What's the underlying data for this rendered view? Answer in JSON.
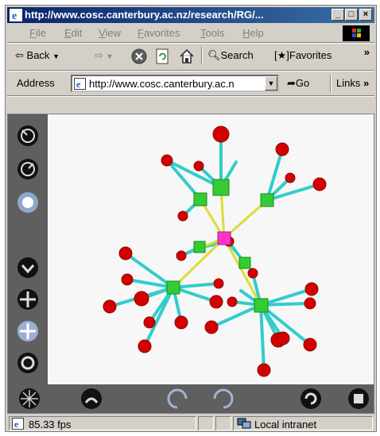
{
  "window": {
    "title": "http://www.cosc.canterbury.ac.nz/research/RG/..."
  },
  "title_buttons": {
    "minimize": "_",
    "maximize": "□",
    "close": "×"
  },
  "menu": [
    {
      "key": "F",
      "rest": "ile"
    },
    {
      "key": "E",
      "rest": "dit"
    },
    {
      "key": "V",
      "rest": "iew"
    },
    {
      "key": "F",
      "rest": "avorites",
      "prefix": ""
    },
    {
      "key": "T",
      "rest": "ools"
    },
    {
      "key": "H",
      "rest": "elp"
    }
  ],
  "toolbar": {
    "back_label": "Back",
    "search_label": "Search",
    "favorites_label": "Favorites",
    "chevron": "»"
  },
  "address": {
    "label": "Address",
    "url": "http://www.cosc.canterbury.ac.n",
    "go_label": "Go",
    "links_label": "Links",
    "chevron": "»"
  },
  "status": {
    "fps_text": "85.33 fps",
    "zone_text": "Local intranet"
  },
  "colors": {
    "titlebar_start": "#0a246a",
    "titlebar_end": "#3a6ea5",
    "panel": "#5f5f5f",
    "node_red": "#d40000",
    "node_green": "#33cc33",
    "node_magenta": "#ff33cc",
    "edge_cyan": "#33cccc",
    "edge_yellow": "#dddd33"
  },
  "left_controls": [
    "rotate-ring-icon",
    "rotate-ring-icon",
    "zoom-ring-icon",
    "pan-down-icon",
    "move-cross-icon",
    "move-cross-icon",
    "orbit-icon"
  ],
  "bottom_controls": [
    "spin-icon",
    "home-icon",
    "rotate-left-icon",
    "rotate-right-icon",
    "refresh-icon",
    "stop-icon"
  ]
}
